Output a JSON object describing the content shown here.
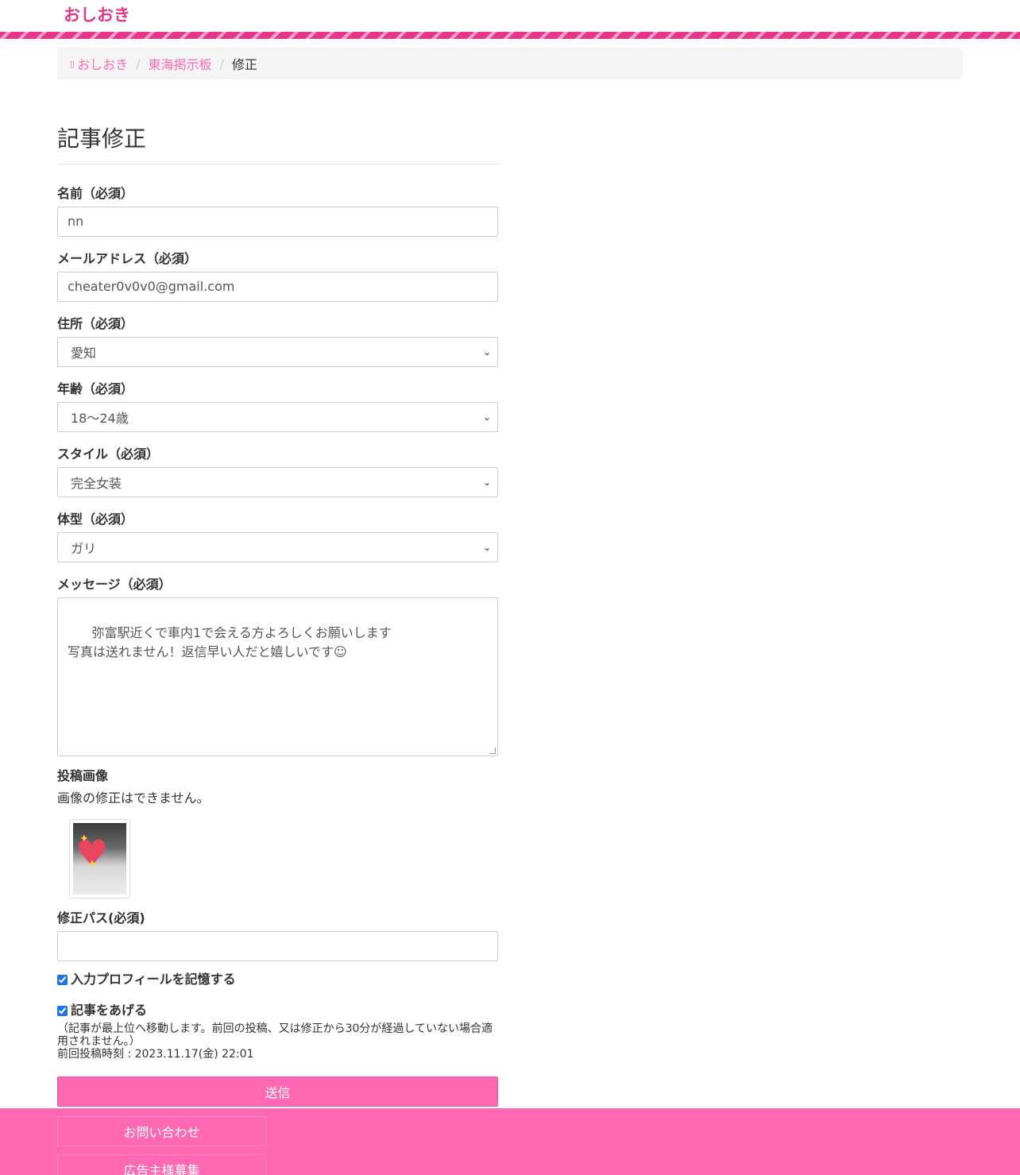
{
  "site": {
    "logo": "おしおき"
  },
  "breadcrumb": {
    "home_icon": "home-icon",
    "items": [
      "おしおき",
      "東海掲示板",
      "修正"
    ]
  },
  "page_title": "記事修正",
  "fields": {
    "name": {
      "label": "名前（必須）",
      "value": "nn"
    },
    "email": {
      "label": "メールアドレス（必須）",
      "value": "cheater0v0v0@gmail.com"
    },
    "address": {
      "label": "住所（必須）",
      "value": "愛知"
    },
    "age": {
      "label": "年齢（必須）",
      "value": "18〜24歳"
    },
    "style": {
      "label": "スタイル（必須）",
      "value": "完全女装"
    },
    "body_type": {
      "label": "体型（必須）",
      "value": "ガリ"
    },
    "message": {
      "label": "メッセージ（必須）",
      "value": "弥富駅近くで車内1で会える方よろしくお願いします\n写真は送れません！返信早い人だと嬉しいです☺"
    },
    "image": {
      "label": "投稿画像",
      "help": "画像の修正はできません。"
    },
    "edit_pass": {
      "label": "修正パス(必須)",
      "value": ""
    }
  },
  "options": {
    "remember_profile": {
      "label": "入力プロフィールを記憶する",
      "checked": true
    },
    "bump_post": {
      "label": "記事をあげる",
      "checked": true
    },
    "bump_note": "（記事が最上位へ移動します。前回の投稿、又は修正から30分が経過していない場合適用されません。）",
    "last_post": "前回投稿時刻 : 2023.11.17(金) 22:01"
  },
  "submit_label": "送信",
  "footer": {
    "links": [
      "お問い合わせ",
      "広告主様募集"
    ]
  },
  "colors": {
    "brand": "#e6358c",
    "accent": "#ff69b4"
  }
}
